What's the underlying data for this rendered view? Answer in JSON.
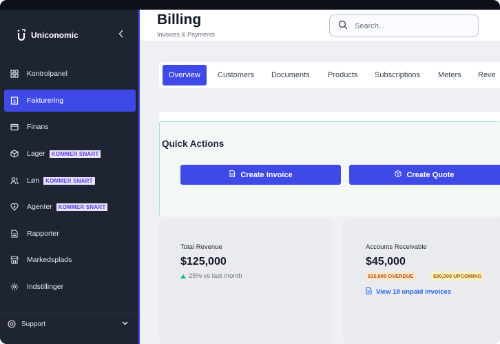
{
  "app": {
    "name": "Uniconomic"
  },
  "sidebar": {
    "items": [
      {
        "label": "Kontrolpanel",
        "icon": "dashboard-icon"
      },
      {
        "label": "Fakturering",
        "icon": "invoice-icon",
        "active": true
      },
      {
        "label": "Finans",
        "icon": "wallet-icon"
      },
      {
        "label": "Lager",
        "icon": "box-icon",
        "badge": "KOMMER SNART"
      },
      {
        "label": "Løn",
        "icon": "users-icon",
        "badge": "KOMMER SNART"
      },
      {
        "label": "Agenter",
        "icon": "agent-icon",
        "badge": "KOMMER SNART"
      },
      {
        "label": "Rapporter",
        "icon": "report-icon"
      },
      {
        "label": "Markedsplads",
        "icon": "store-icon"
      },
      {
        "label": "Indstillinger",
        "icon": "gear-icon"
      }
    ],
    "support": {
      "label": "Support"
    }
  },
  "header": {
    "title": "Billing",
    "subtitle": "Invoices & Payments",
    "search_placeholder": "Search..."
  },
  "tabs": [
    "Overview",
    "Customers",
    "Documents",
    "Products",
    "Subscriptions",
    "Meters",
    "Reve"
  ],
  "quick_actions": {
    "title": "Quick Actions",
    "create_invoice": "Create Invoice",
    "create_quote": "Create Quote"
  },
  "stats": {
    "revenue": {
      "label": "Total Revenue",
      "value": "$125,000",
      "trend": "25% vs last month"
    },
    "receivable": {
      "label": "Accounts Receivable",
      "value": "$45,000",
      "overdue": "$15,000 OVERDUE",
      "upcoming": "$30,000 UPCOMING",
      "link": "View 18 unpaid invoices"
    }
  },
  "colors": {
    "accent": "#3f49e6",
    "sidebar": "#1f2433",
    "badge_bg": "#e8e4ff",
    "badge_text": "#5b3fd6"
  }
}
